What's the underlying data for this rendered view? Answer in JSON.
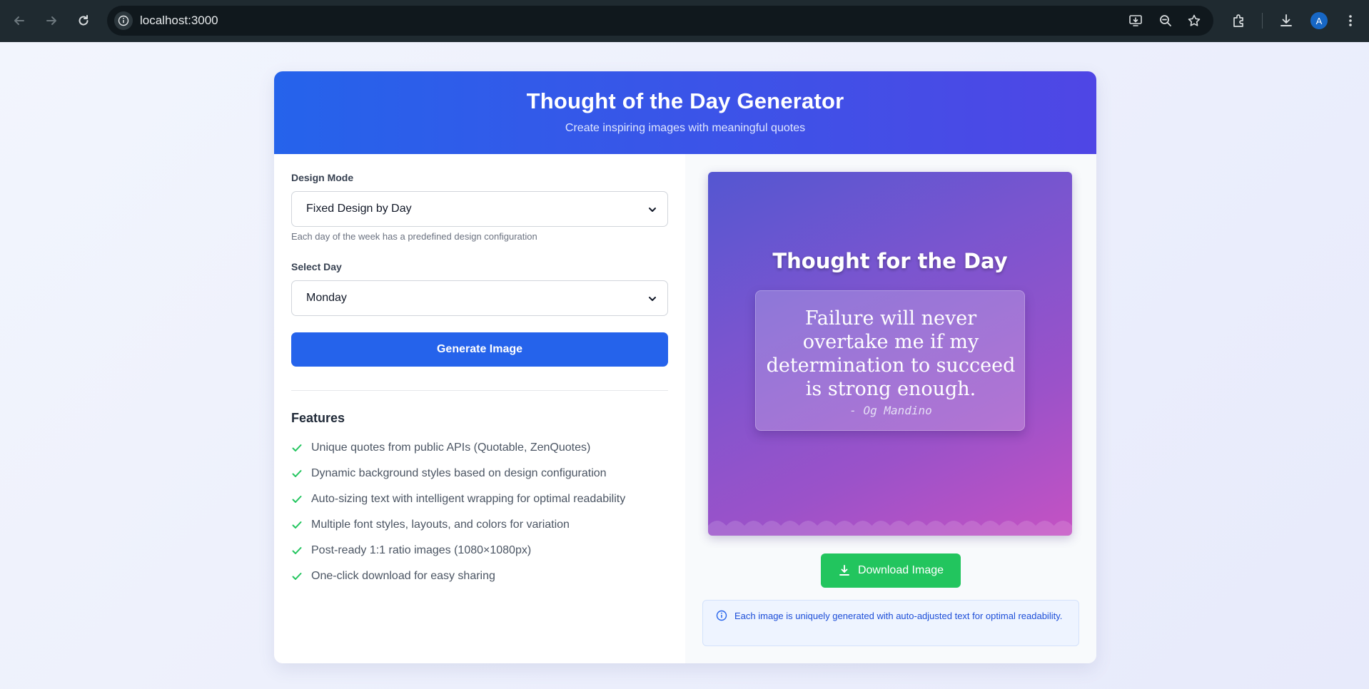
{
  "browser": {
    "url": "localhost:3000",
    "profile_initial": "A"
  },
  "header": {
    "title": "Thought of the Day Generator",
    "subtitle": "Create inspiring images with meaningful quotes"
  },
  "form": {
    "design_mode_label": "Design Mode",
    "design_mode_value": "Fixed Design by Day",
    "design_mode_hint": "Each day of the week has a predefined design configuration",
    "day_label": "Select Day",
    "day_value": "Monday",
    "generate_label": "Generate Image"
  },
  "features": {
    "title": "Features",
    "items": [
      "Unique quotes from public APIs (Quotable, ZenQuotes)",
      "Dynamic background styles based on design configuration",
      "Auto-sizing text with intelligent wrapping for optimal readability",
      "Multiple font styles, layouts, and colors for variation",
      "Post-ready 1:1 ratio images (1080×1080px)",
      "One-click download for easy sharing"
    ]
  },
  "preview": {
    "title": "Thought for the Day",
    "quote": "Failure will never overtake me if my determination to succeed is strong enough.",
    "author": "- Og Mandino"
  },
  "download_label": "Download Image",
  "info_text": "Each image is uniquely generated with auto-adjusted text for optimal readability.",
  "colors": {
    "primary": "#2563eb",
    "success": "#22c55e",
    "check": "#22c55e"
  },
  "icons": {
    "back": "back-arrow-icon",
    "forward": "forward-arrow-icon",
    "reload": "reload-icon",
    "info": "info-icon",
    "check": "check-icon",
    "download": "download-icon"
  }
}
